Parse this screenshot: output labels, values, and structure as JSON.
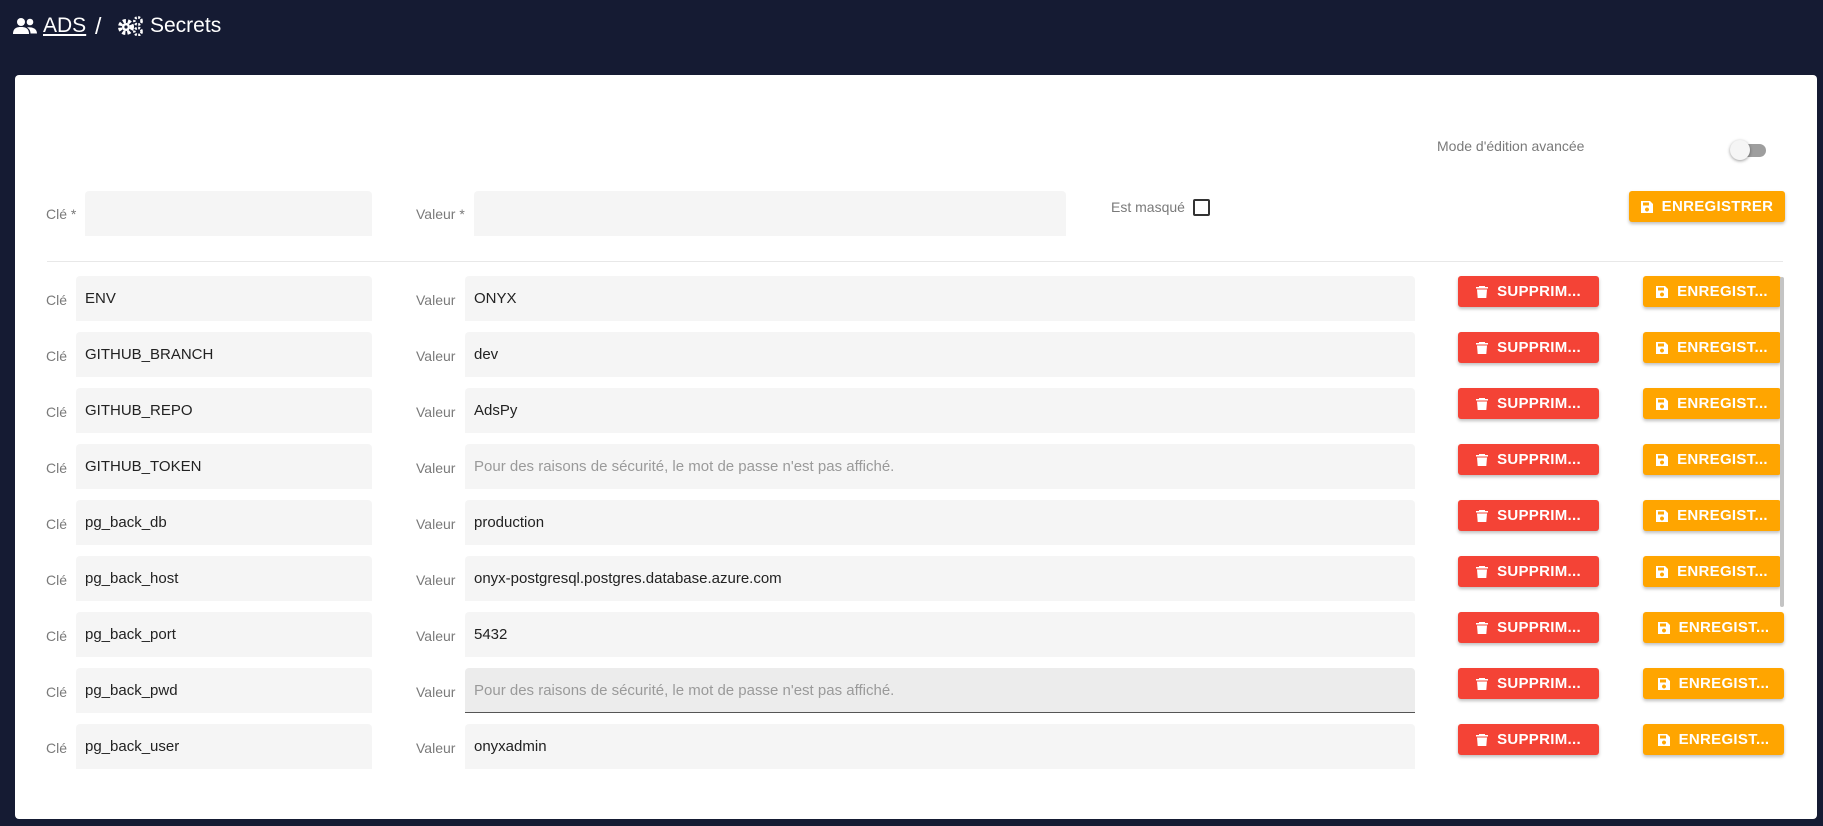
{
  "breadcrumb": {
    "root_label": "ADS",
    "separator": "/",
    "current_label": "Secrets",
    "root_icon": "users-icon",
    "current_icon": "gears-icon"
  },
  "advanced_mode": {
    "label": "Mode d'édition avancée",
    "enabled": false
  },
  "new_secret": {
    "key_label": "Clé *",
    "key_value": "",
    "value_label": "Valeur *",
    "value_value": "",
    "masked_label": "Est masqué",
    "masked_checked": false,
    "save_label": "ENREGISTRER"
  },
  "secrets_labels": {
    "key": "Clé",
    "value": "Valeur",
    "delete": "SUPPRIM...",
    "save": "ENREGIST...",
    "masked_placeholder": "Pour des raisons de sécurité, le mot de passe n'est pas affiché."
  },
  "secrets": [
    {
      "key": "ENV",
      "value": "ONYX",
      "masked": false
    },
    {
      "key": "GITHUB_BRANCH",
      "value": "dev",
      "masked": false
    },
    {
      "key": "GITHUB_REPO",
      "value": "AdsPy",
      "masked": false
    },
    {
      "key": "GITHUB_TOKEN",
      "value": "",
      "masked": true
    },
    {
      "key": "pg_back_db",
      "value": "production",
      "masked": false
    },
    {
      "key": "pg_back_host",
      "value": "onyx-postgresql.postgres.database.azure.com",
      "masked": false
    },
    {
      "key": "pg_back_port",
      "value": "5432",
      "masked": false
    },
    {
      "key": "pg_back_pwd",
      "value": "",
      "masked": true,
      "focused": true
    },
    {
      "key": "pg_back_user",
      "value": "onyxadmin",
      "masked": false
    }
  ],
  "colors": {
    "header_bg": "#151b33",
    "delete_button": "#f44336",
    "save_button": "#ffa500"
  }
}
